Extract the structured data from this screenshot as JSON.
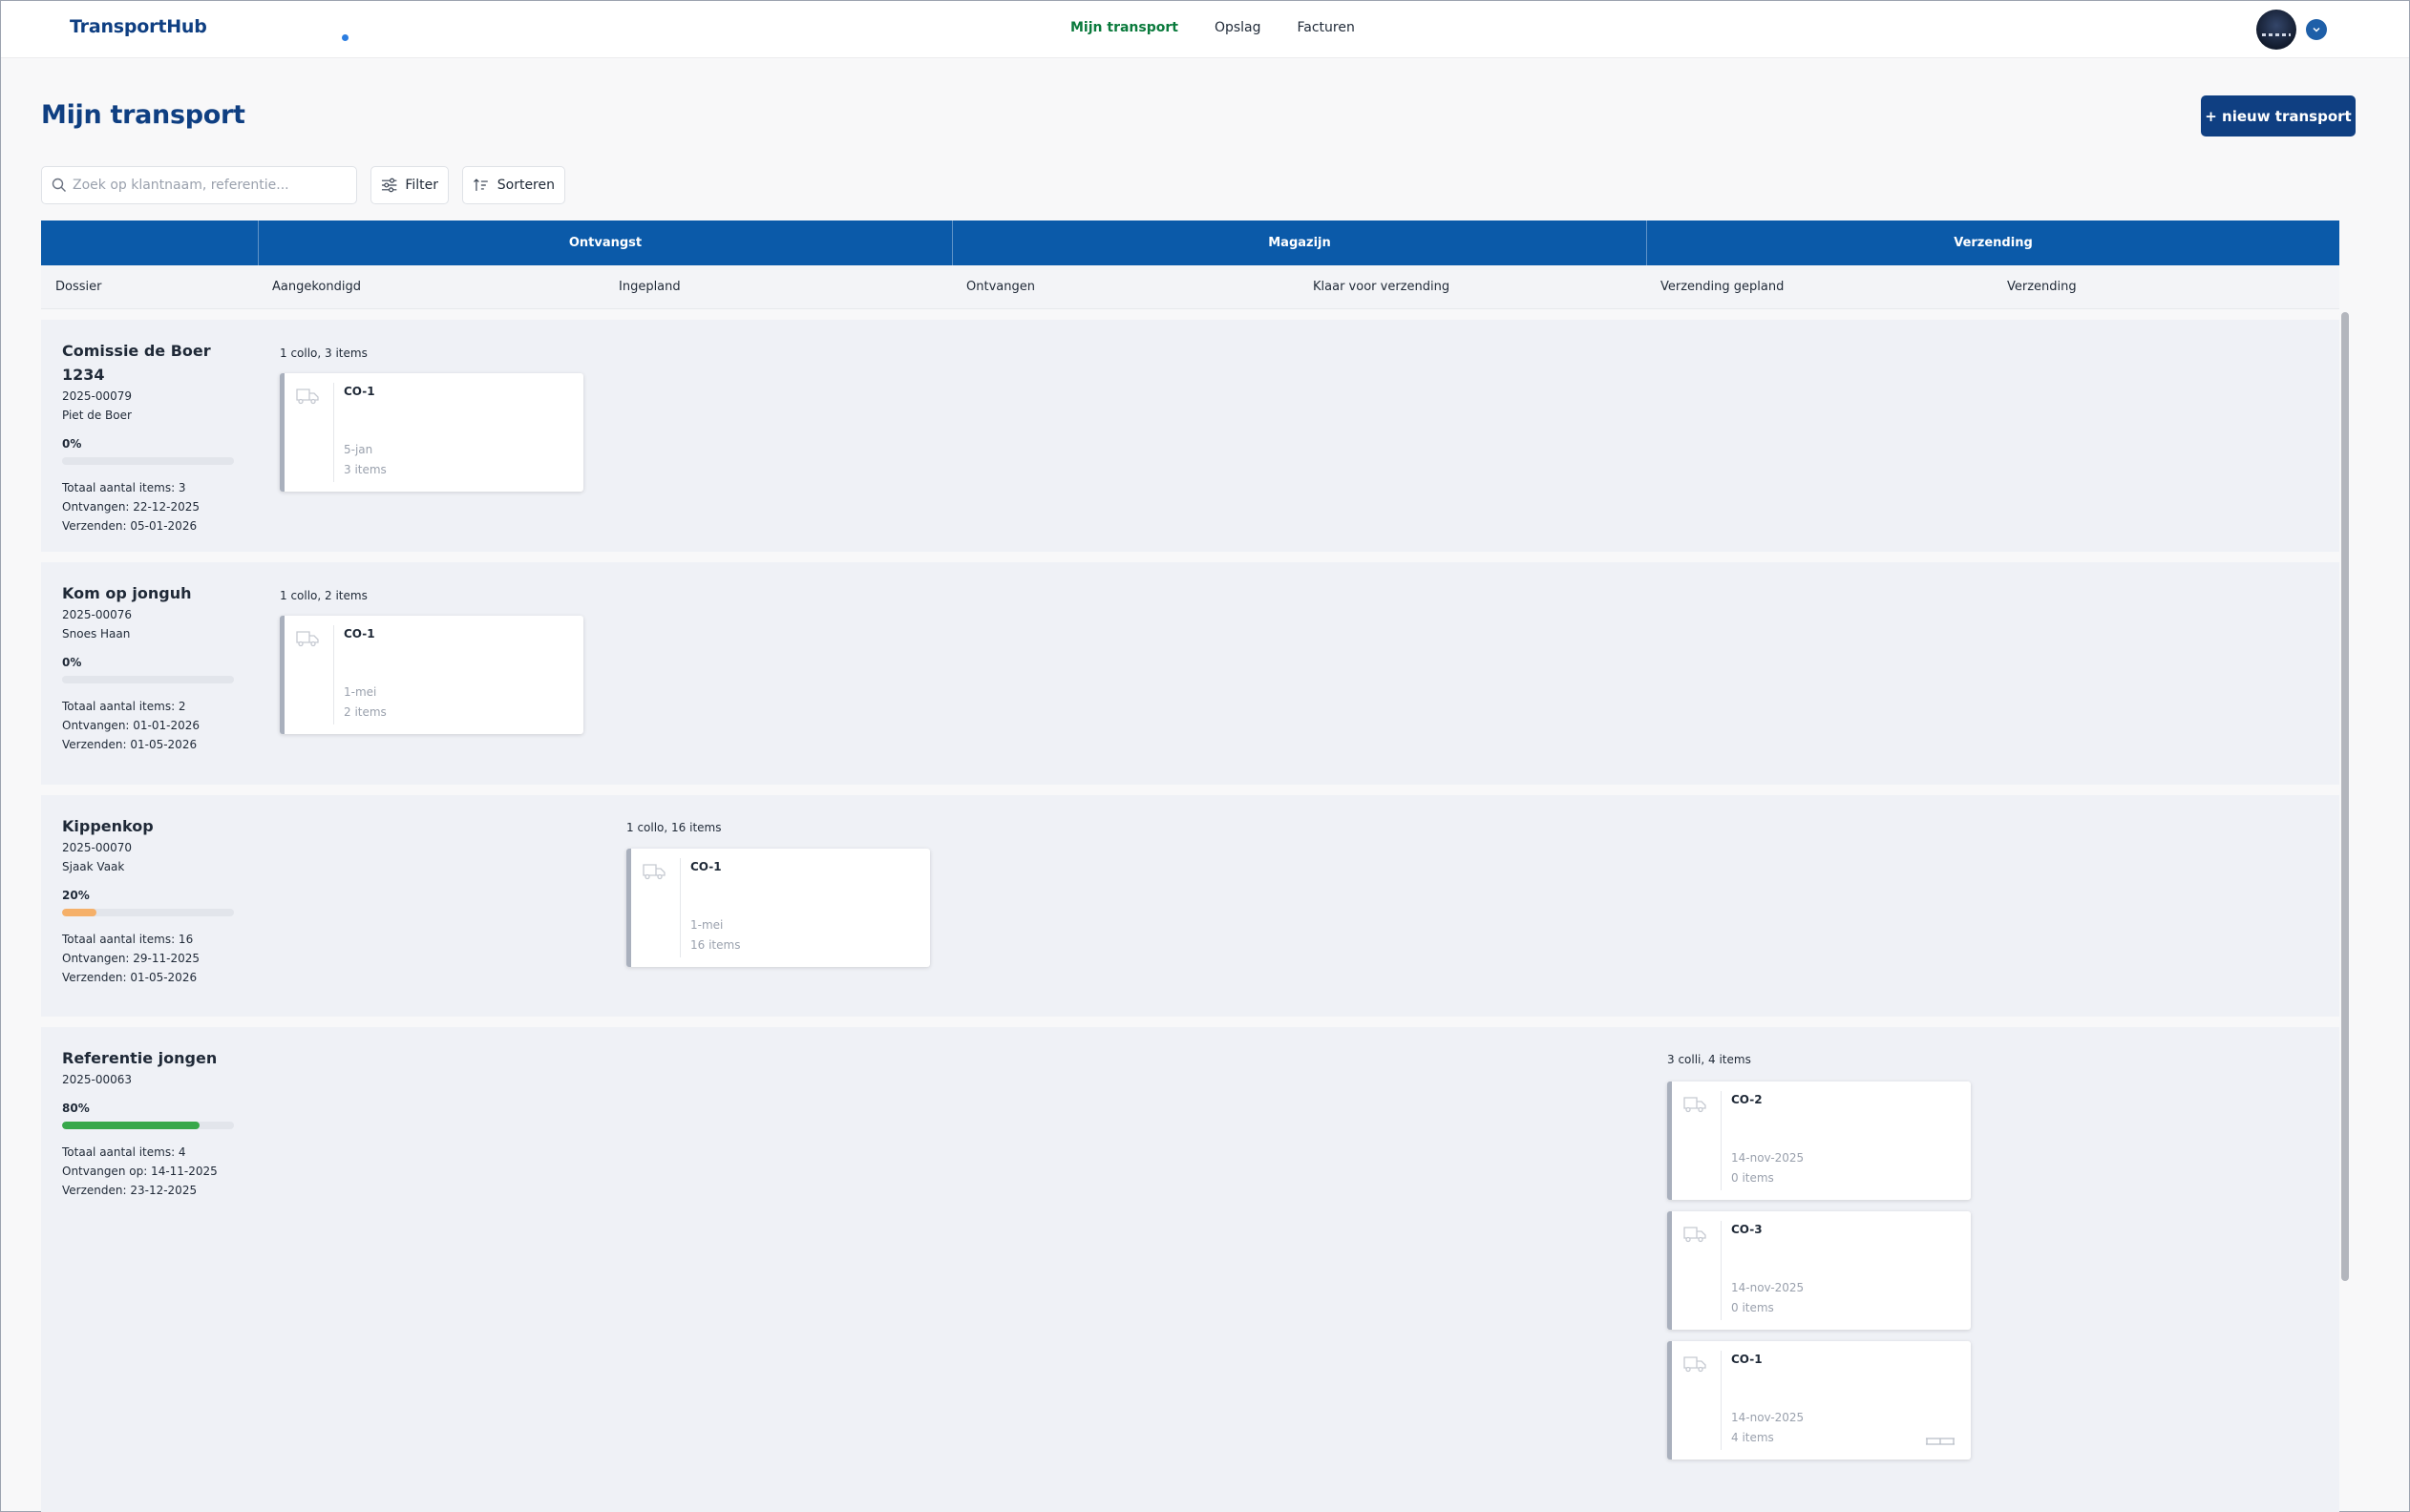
{
  "app": {
    "logo": "TransportHub"
  },
  "nav": [
    {
      "label": "Mijn transport",
      "active": true
    },
    {
      "label": "Opslag",
      "active": false
    },
    {
      "label": "Facturen",
      "active": false
    }
  ],
  "page": {
    "title": "Mijn transport",
    "new_button": "+ nieuw transport"
  },
  "toolbar": {
    "search_placeholder": "Zoek op klantnaam, referentie...",
    "filter_label": "Filter",
    "sort_label": "Sorteren"
  },
  "table": {
    "groups": [
      "Ontvangst",
      "Magazijn",
      "Verzending"
    ],
    "columns": [
      "Dossier",
      "Aangekondigd",
      "Ingepland",
      "Ontvangen",
      "Klaar voor verzending",
      "Verzending gepland",
      "Verzending"
    ]
  },
  "colors": {
    "primary": "#0f3f82",
    "header": "#0b5aa9",
    "active_nav": "#0a7a3c",
    "progress_orange": "#f5b069",
    "progress_green": "#37a84a"
  },
  "rows": [
    {
      "name": "Comissie de Boer 1234",
      "number": "2025-00079",
      "customer": "Piet de Boer",
      "percent": "0%",
      "progress": 0,
      "total": "Totaal aantal items: 3",
      "received": "Ontvangen: 22-12-2025",
      "ship": "Verzenden: 05-01-2026",
      "colli_label": "1 collo, 3 items",
      "column": "Aangekondigd",
      "cards": [
        {
          "title": "CO-1",
          "date": "5-jan",
          "items": "3 items"
        }
      ]
    },
    {
      "name": "Kom op jonguh",
      "number": "2025-00076",
      "customer": "Snoes Haan",
      "percent": "0%",
      "progress": 0,
      "total": "Totaal aantal items: 2",
      "received": "Ontvangen: 01-01-2026",
      "ship": "Verzenden: 01-05-2026",
      "colli_label": "1 collo, 2 items",
      "column": "Aangekondigd",
      "cards": [
        {
          "title": "CO-1",
          "date": "1-mei",
          "items": "2 items"
        }
      ]
    },
    {
      "name": "Kippenkop",
      "number": "2025-00070",
      "customer": "Sjaak Vaak",
      "percent": "20%",
      "progress": 0.2,
      "total": "Totaal aantal items: 16",
      "received": "Ontvangen: 29-11-2025",
      "ship": "Verzenden: 01-05-2026",
      "colli_label": "1 collo, 16 items",
      "column": "Ingepland",
      "cards": [
        {
          "title": "CO-1",
          "date": "1-mei",
          "items": "16 items"
        }
      ]
    },
    {
      "name": "Referentie jongen",
      "number": "2025-00063",
      "customer": "",
      "percent": "80%",
      "progress": 0.8,
      "total": "Totaal aantal items: 4",
      "received": "Ontvangen op: 14-11-2025",
      "ship": "Verzenden: 23-12-2025",
      "colli_label": "3 colli, 4 items",
      "column": "Verzending gepland",
      "cards": [
        {
          "title": "CO-2",
          "date": "14-nov-2025",
          "items": "0 items"
        },
        {
          "title": "CO-3",
          "date": "14-nov-2025",
          "items": "0 items"
        },
        {
          "title": "CO-1",
          "date": "14-nov-2025",
          "items": "4 items",
          "pallet": true
        }
      ]
    }
  ]
}
